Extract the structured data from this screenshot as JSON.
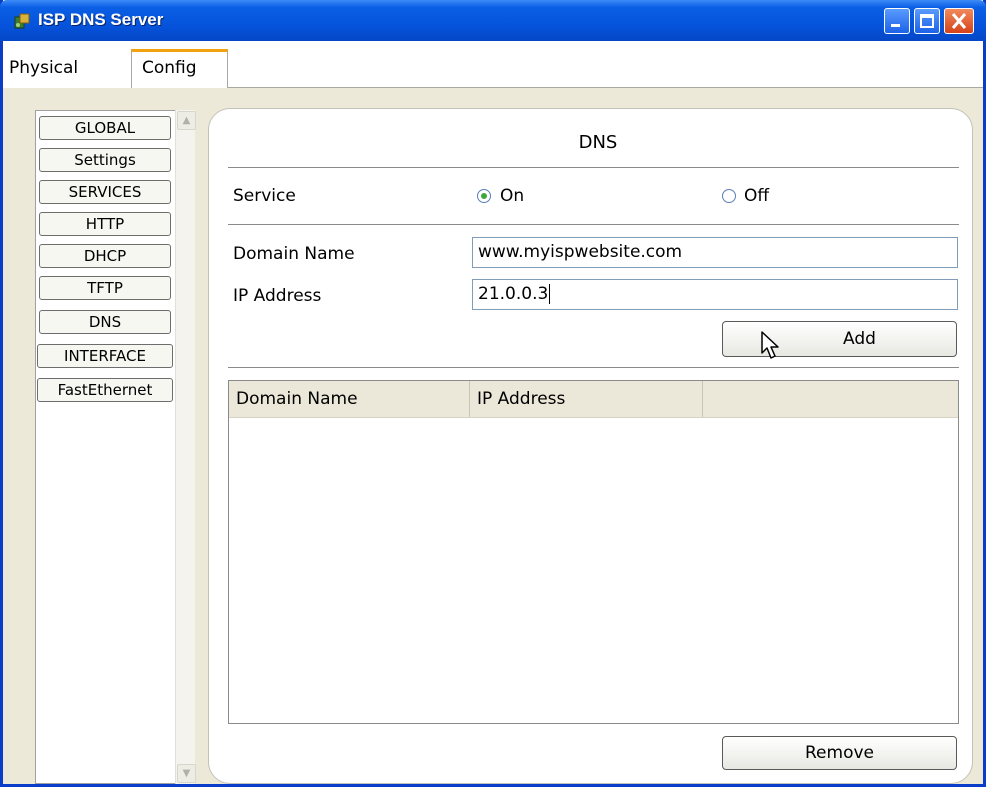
{
  "window": {
    "title": "ISP DNS Server"
  },
  "tabs": [
    {
      "label": "Physical"
    },
    {
      "label": "Config"
    }
  ],
  "sidebar": {
    "items": [
      {
        "label": "GLOBAL"
      },
      {
        "label": "Settings"
      },
      {
        "label": "SERVICES"
      },
      {
        "label": "HTTP"
      },
      {
        "label": "DHCP"
      },
      {
        "label": "TFTP"
      },
      {
        "label": "DNS"
      },
      {
        "label": "INTERFACE"
      },
      {
        "label": "FastEthernet"
      }
    ]
  },
  "dns": {
    "title": "DNS",
    "service_label": "Service",
    "service_on_label": "On",
    "service_off_label": "Off",
    "service_selected": "On",
    "domain_name_label": "Domain Name",
    "domain_name_value": "www.myispwebsite.com",
    "ip_address_label": "IP Address",
    "ip_address_value": "21.0.0.3",
    "add_button": "Add",
    "remove_button": "Remove",
    "table": {
      "columns": [
        "Domain Name",
        "IP Address"
      ],
      "rows": []
    }
  },
  "colors": {
    "titlebar": "#0654dc",
    "active_tab_accent": "#f3a20f",
    "radio_selected": "#3aa83a"
  }
}
